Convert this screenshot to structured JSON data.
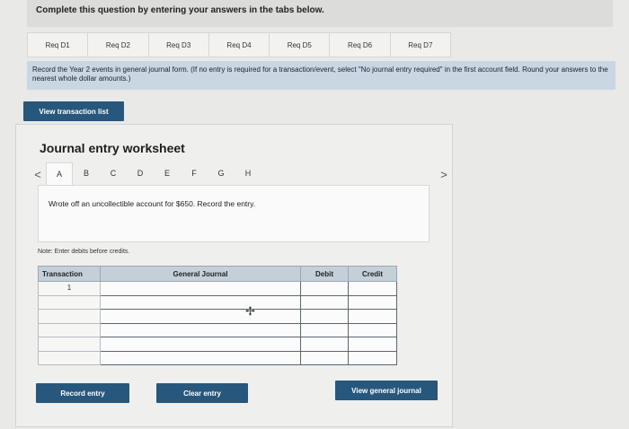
{
  "instructions_top": "Complete this question by entering your answers in the tabs below.",
  "req_tabs": [
    "Req D1",
    "Req D2",
    "Req D3",
    "Req D4",
    "Req D5",
    "Req D6",
    "Req D7"
  ],
  "instruction_text": "Record the Year 2 events in general journal form. (If no entry is required for a transaction/event, select \"No journal entry required\" in the first account field. Round your answers to the nearest whole dollar amounts.)",
  "view_transaction_list": "View transaction list",
  "worksheet": {
    "title": "Journal entry worksheet",
    "prev_arrow": "<",
    "next_arrow": ">",
    "letters": [
      "A",
      "B",
      "C",
      "D",
      "E",
      "F",
      "G",
      "H"
    ],
    "active_letter": "A",
    "entry_text": "Wrote off an uncollectible account for $650. Record the entry.",
    "note": "Note: Enter debits before credits.",
    "table": {
      "headers": {
        "transaction": "Transaction",
        "journal": "General Journal",
        "debit": "Debit",
        "credit": "Credit"
      },
      "rows": [
        {
          "transaction": "1",
          "account": "",
          "debit": "",
          "credit": ""
        },
        {
          "transaction": "",
          "account": "",
          "debit": "",
          "credit": ""
        },
        {
          "transaction": "",
          "account": "",
          "debit": "",
          "credit": ""
        },
        {
          "transaction": "",
          "account": "",
          "debit": "",
          "credit": ""
        },
        {
          "transaction": "",
          "account": "",
          "debit": "",
          "credit": ""
        },
        {
          "transaction": "",
          "account": "",
          "debit": "",
          "credit": ""
        }
      ]
    },
    "buttons": {
      "record": "Record entry",
      "clear": "Clear entry",
      "view_journal": "View general journal"
    }
  },
  "colors": {
    "button": "#27577c",
    "instruction_bg": "#c9d7e3",
    "header_bg": "#c4cfd8"
  }
}
